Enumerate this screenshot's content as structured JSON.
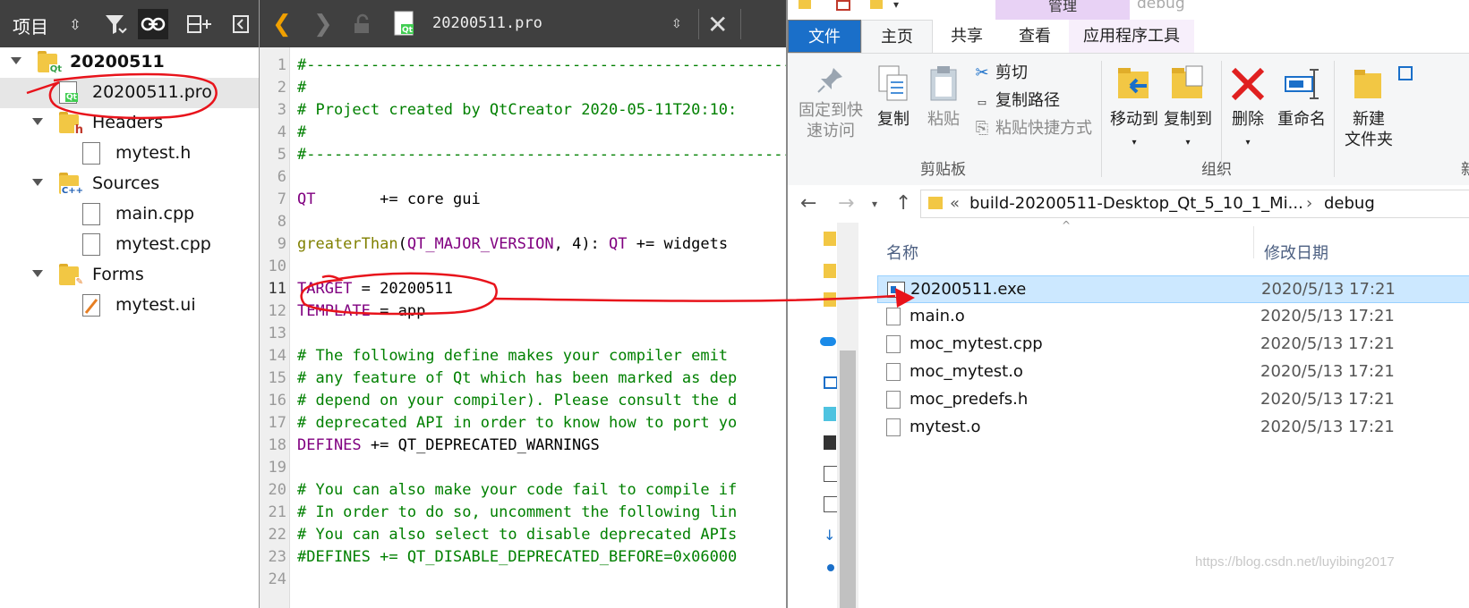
{
  "project_panel": {
    "title": "项目",
    "tree": [
      {
        "label": "20200511",
        "kind": "project"
      },
      {
        "label": "20200511.pro",
        "kind": "pro-file"
      },
      {
        "label": "Headers",
        "kind": "folder-headers"
      },
      {
        "label": "mytest.h",
        "kind": "file"
      },
      {
        "label": "Sources",
        "kind": "folder-sources"
      },
      {
        "label": "main.cpp",
        "kind": "file"
      },
      {
        "label": "mytest.cpp",
        "kind": "file"
      },
      {
        "label": "Forms",
        "kind": "folder-forms"
      },
      {
        "label": "mytest.ui",
        "kind": "ui-file"
      }
    ]
  },
  "editor": {
    "file_name": "20200511.pro",
    "line_numbers": [
      "1",
      "2",
      "3",
      "4",
      "5",
      "6",
      "7",
      "8",
      "9",
      "10",
      "11",
      "12",
      "13",
      "14",
      "15",
      "16",
      "17",
      "18",
      "19",
      "20",
      "21",
      "22",
      "23",
      "24"
    ],
    "lines": {
      "l1": "#---------------------------------------------------------",
      "l2": "#",
      "l3": "# Project created by QtCreator 2020-05-11T20:10:",
      "l4": "#",
      "l5": "#---------------------------------------------------------",
      "l7_kw": "QT",
      "l7_rest": "       += core gui",
      "l9_fn": "greaterThan",
      "l9_a": "(",
      "l9_kw": "QT_MAJOR_VERSION",
      "l9_b": ", 4): ",
      "l9_kw2": "QT",
      "l9_c": " += widgets",
      "l11_kw": "TARGET",
      "l11_rest": " = 20200511",
      "l12_kw": "TEMPLATE",
      "l12_rest": " = app",
      "l14": "# The following define makes your compiler emit",
      "l15": "# any feature of Qt which has been marked as dep",
      "l16": "# depend on your compiler). Please consult the d",
      "l17": "# deprecated API in order to know how to port yo",
      "l18_kw": "DEFINES",
      "l18_rest": " += QT_DEPRECATED_WARNINGS",
      "l20": "# You can also make your code fail to compile if",
      "l21": "# In order to do so, uncomment the following lin",
      "l22": "# You can also select to disable deprecated APIs",
      "l23": "#DEFINES += QT_DISABLE_DEPRECATED_BEFORE=0x06000"
    }
  },
  "explorer": {
    "ribbon_tabs": {
      "file": "文件",
      "home": "主页",
      "share": "共享",
      "view": "查看",
      "app_tools": "应用程序工具"
    },
    "context_tab": "管理",
    "context_sub": "debug",
    "clipboard": {
      "pin": "固定到快速访问",
      "pin_l1": "固定到快",
      "pin_l2": "速访问",
      "copy": "复制",
      "paste": "粘贴",
      "cut": "剪切",
      "copy_path": "复制路径",
      "paste_shortcut": "粘贴快捷方式",
      "group": "剪贴板"
    },
    "organize": {
      "move_to": "移动到",
      "copy_to": "复制到",
      "delete": "删除",
      "rename": "重命名",
      "group": "组织"
    },
    "new": {
      "new_l1": "新建",
      "new_l2": "文件夹",
      "group": "新"
    },
    "address": {
      "chevron": "«",
      "parent": "build-20200511-Desktop_Qt_5_10_1_Mi...",
      "sep": "›",
      "current": "debug"
    },
    "columns": {
      "name": "名称",
      "date": "修改日期"
    },
    "files": [
      {
        "name": "20200511.exe",
        "date": "2020/5/13 17:21",
        "type": "exe"
      },
      {
        "name": "main.o",
        "date": "2020/5/13 17:21",
        "type": "file"
      },
      {
        "name": "moc_mytest.cpp",
        "date": "2020/5/13 17:21",
        "type": "file"
      },
      {
        "name": "moc_mytest.o",
        "date": "2020/5/13 17:21",
        "type": "file"
      },
      {
        "name": "moc_predefs.h",
        "date": "2020/5/13 17:21",
        "type": "file"
      },
      {
        "name": "mytest.o",
        "date": "2020/5/13 17:21",
        "type": "file"
      }
    ]
  },
  "watermark": "https://blog.csdn.net/luyibing2017",
  "colors": {
    "annotation_red": "#e8131b",
    "ribbon_file_blue": "#1a6fc9",
    "selection_blue": "#cce8ff",
    "context_tab_purple": "#e8d2f5"
  }
}
